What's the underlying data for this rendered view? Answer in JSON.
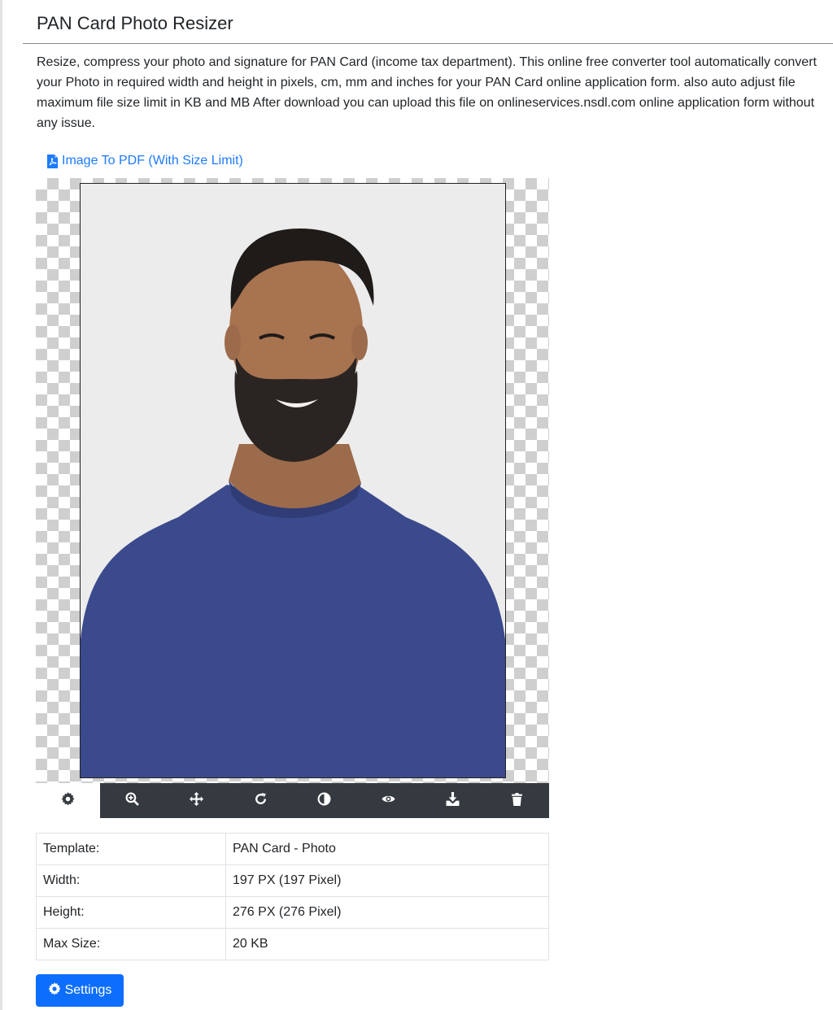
{
  "page": {
    "title": "PAN Card Photo Resizer",
    "description": "Resize, compress your photo and signature for PAN Card (income tax department). This online free converter tool automatically convert your Photo in required width and height in pixels, cm, mm and inches for your PAN Card online application form. also auto adjust file maximum file size limit in KB and MB After download you can upload this file on onlineservices.nsdl.com online application form without any issue."
  },
  "link": {
    "label": "Image To PDF (With Size Limit)",
    "icon": "file-pdf-icon"
  },
  "toolbar": {
    "tools": [
      {
        "icon": "gear-icon",
        "active": true
      },
      {
        "icon": "zoom-in-icon",
        "active": false
      },
      {
        "icon": "move-icon",
        "active": false
      },
      {
        "icon": "rotate-icon",
        "active": false
      },
      {
        "icon": "contrast-icon",
        "active": false
      },
      {
        "icon": "eye-icon",
        "active": false
      },
      {
        "icon": "download-icon",
        "active": false
      },
      {
        "icon": "trash-icon",
        "active": false
      }
    ]
  },
  "info": {
    "rows": [
      {
        "label": "Template:",
        "value": "PAN Card - Photo"
      },
      {
        "label": "Width:",
        "value": "197 PX (197 Pixel)"
      },
      {
        "label": "Height:",
        "value": "276 PX (276 Pixel)"
      },
      {
        "label": "Max Size:",
        "value": "20 KB"
      }
    ]
  },
  "settings_button": {
    "label": "Settings",
    "icon": "gear-icon"
  },
  "colors": {
    "toolbar_bg": "#343a40",
    "link": "#1d7bff",
    "primary_button": "#0d6efd",
    "shirt": "#3b4a8c"
  }
}
